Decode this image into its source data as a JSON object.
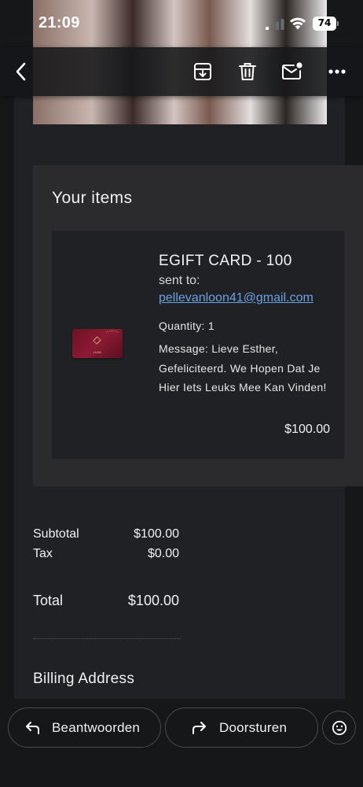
{
  "status": {
    "time": "21:09",
    "battery": "74"
  },
  "toolbar": {
    "back_icon": "chevron-left-icon",
    "archive_icon": "archive-icon",
    "delete_icon": "trash-icon",
    "unread_icon": "mail-unread-icon",
    "more_icon": "more-horizontal-icon"
  },
  "email": {
    "items_title": "Your items",
    "item": {
      "name": "EGIFT CARD - 100",
      "sent_to_label": "sent to:",
      "recipient": "pellevanloon41@gmail.com",
      "quantity": "Quantity: 1",
      "message": "Message: Lieve Esther, Gefeliciteerd. We Hopen Dat Je Hier Iets Leuks Mee Kan Vinden!",
      "price": "$100.00"
    },
    "summary": {
      "subtotal_label": "Subtotal",
      "subtotal_value": "$100.00",
      "tax_label": "Tax",
      "tax_value": "$0.00",
      "total_label": "Total",
      "total_value": "$100.00"
    },
    "billing_title": "Billing Address"
  },
  "actions": {
    "reply_label": "Beantwoorden",
    "forward_label": "Doorsturen",
    "emoji_icon": "smiley-icon"
  },
  "colors": {
    "background": "#161719",
    "card": "#202124",
    "panel": "#2b2b2d",
    "link": "#6aa2e6"
  }
}
